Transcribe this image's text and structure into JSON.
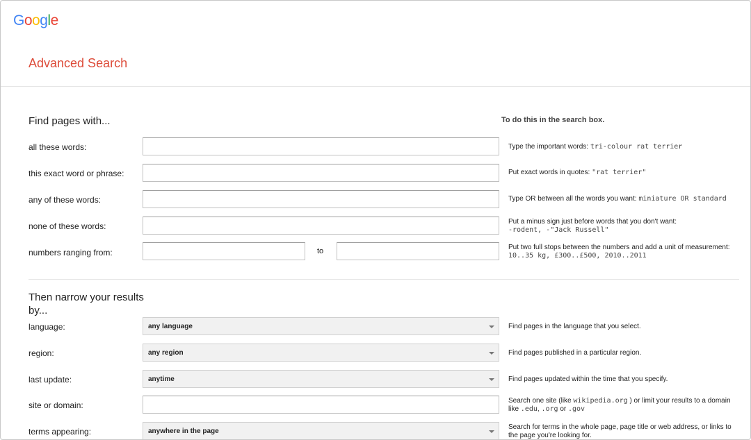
{
  "logo": {
    "letters": [
      "G",
      "o",
      "o",
      "g",
      "l",
      "e"
    ],
    "colors": [
      "#4285f4",
      "#ea4335",
      "#fbbc05",
      "#4285f4",
      "#34a853",
      "#ea4335"
    ]
  },
  "page_title": "Advanced Search",
  "find_section": {
    "heading": "Find pages with...",
    "hint_heading": "To do this in the search box.",
    "all_words": {
      "label": "all these words:",
      "value": "",
      "hint_text": "Type the important words: ",
      "hint_example": "tri-colour rat terrier"
    },
    "exact_phrase": {
      "label": "this exact word or phrase:",
      "value": "",
      "hint_text": "Put exact words in quotes: ",
      "hint_example": "\"rat terrier\""
    },
    "any_words": {
      "label": "any of these words:",
      "value": "",
      "hint_text": "Type OR between all the words you want: ",
      "hint_example": "miniature OR standard"
    },
    "none_words": {
      "label": "none of these words:",
      "value": "",
      "hint_text": "Put a minus sign just before words that you don't want:",
      "hint_example": "-rodent, -\"Jack Russell\""
    },
    "numbers_range": {
      "label": "numbers ranging from:",
      "from_value": "",
      "to_label": "to",
      "to_value": "",
      "hint_text": "Put two full stops between the numbers and add a unit of measurement:",
      "hint_example": "10..35 kg, £300..£500, 2010..2011"
    }
  },
  "narrow_section": {
    "heading": "Then narrow your results by...",
    "language": {
      "label": "language:",
      "selected": "any language",
      "hint_text": "Find pages in the language that you select."
    },
    "region": {
      "label": "region:",
      "selected": "any region",
      "hint_text": "Find pages published in a particular region."
    },
    "last_update": {
      "label": "last update:",
      "selected": "anytime",
      "hint_text": "Find pages updated within the time that you specify."
    },
    "site_domain": {
      "label": "site or domain:",
      "value": "",
      "hint_pre": "Search one site (like ",
      "hint_ex1": "wikipedia.org",
      "hint_mid": " ) or limit your results to a domain like ",
      "hint_ex2": ".edu",
      "hint_sep": ", ",
      "hint_ex3": ".org",
      "hint_or": " or ",
      "hint_ex4": ".gov"
    },
    "terms_appearing": {
      "label": "terms appearing:",
      "selected": "anywhere in the page",
      "hint_text": "Search for terms in the whole page, page title or web address, or links to the page you're looking for."
    }
  }
}
